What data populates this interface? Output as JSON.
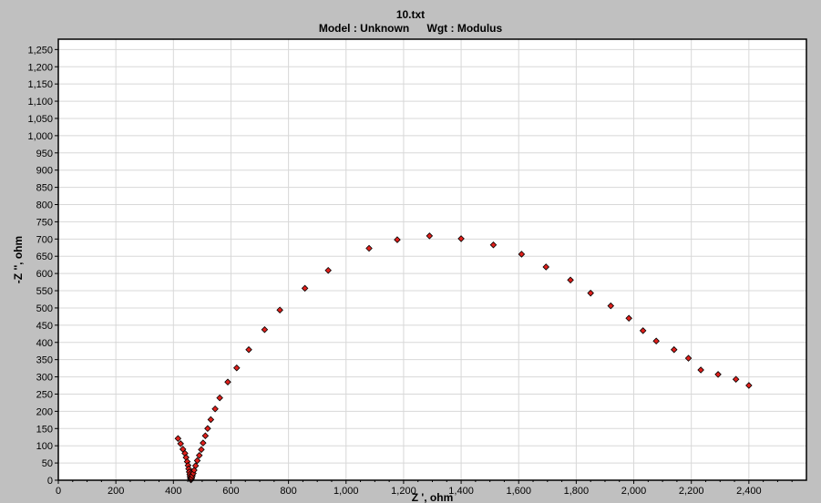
{
  "header": {
    "title": "10.txt",
    "model_label": "Model : Unknown",
    "weight_label": "Wgt : Modulus"
  },
  "colors": {
    "background": "#c0c0c0",
    "plot_background": "#ffffff",
    "grid": "#d8d8d8",
    "point_fill": "#e0201c",
    "point_stroke": "#000000"
  },
  "chart_data": {
    "type": "scatter",
    "title": "10.txt",
    "subtitle": "Model : Unknown     Wgt : Modulus",
    "xlabel": "Z ', ohm",
    "ylabel": "-Z '', ohm",
    "xlim": [
      0,
      2600
    ],
    "ylim": [
      0,
      1280
    ],
    "xticks": [
      0,
      200,
      400,
      600,
      800,
      1000,
      1200,
      1400,
      1600,
      1800,
      2000,
      2200,
      2400
    ],
    "xtick_labels": [
      "0",
      "200",
      "400",
      "600",
      "800",
      "1,000",
      "1,200",
      "1,400",
      "1,600",
      "1,800",
      "2,000",
      "2,200",
      "2,400"
    ],
    "yticks": [
      0,
      50,
      100,
      150,
      200,
      250,
      300,
      350,
      400,
      450,
      500,
      550,
      600,
      650,
      700,
      750,
      800,
      850,
      900,
      950,
      1000,
      1050,
      1100,
      1150,
      1200,
      1250
    ],
    "ytick_labels": [
      "0",
      "50",
      "100",
      "150",
      "200",
      "250",
      "300",
      "350",
      "400",
      "450",
      "500",
      "550",
      "600",
      "650",
      "700",
      "750",
      "800",
      "850",
      "900",
      "950",
      "1,000",
      "1,050",
      "1,100",
      "1,150",
      "1,200",
      "1,250"
    ],
    "grid": true,
    "legend": "none",
    "series": [
      {
        "points": [
          [
            416,
            121
          ],
          [
            425,
            106
          ],
          [
            433,
            90
          ],
          [
            440,
            78
          ],
          [
            444,
            66
          ],
          [
            448,
            54
          ],
          [
            451,
            43
          ],
          [
            453,
            33
          ],
          [
            455,
            24
          ],
          [
            457,
            17
          ],
          [
            458,
            11
          ],
          [
            459,
            6
          ],
          [
            460,
            3
          ],
          [
            461,
            1
          ],
          [
            462,
            3
          ],
          [
            464,
            7
          ],
          [
            466,
            13
          ],
          [
            469,
            20
          ],
          [
            472,
            29
          ],
          [
            477,
            42
          ],
          [
            483,
            57
          ],
          [
            490,
            72
          ],
          [
            497,
            89
          ],
          [
            503,
            108
          ],
          [
            511,
            129
          ],
          [
            519,
            150
          ],
          [
            530,
            176
          ],
          [
            545,
            207
          ],
          [
            561,
            239
          ],
          [
            589,
            285
          ],
          [
            620,
            326
          ],
          [
            662,
            379
          ],
          [
            717,
            437
          ],
          [
            770,
            494
          ],
          [
            857,
            557
          ],
          [
            938,
            609
          ],
          [
            1080,
            673
          ],
          [
            1178,
            698
          ],
          [
            1290,
            709
          ],
          [
            1400,
            701
          ],
          [
            1512,
            683
          ],
          [
            1610,
            656
          ],
          [
            1695,
            619
          ],
          [
            1780,
            581
          ],
          [
            1850,
            543
          ],
          [
            1920,
            506
          ],
          [
            1983,
            470
          ],
          [
            2032,
            434
          ],
          [
            2078,
            404
          ],
          [
            2140,
            379
          ],
          [
            2190,
            354
          ],
          [
            2233,
            320
          ],
          [
            2293,
            307
          ],
          [
            2355,
            293
          ],
          [
            2400,
            275
          ]
        ]
      }
    ]
  }
}
